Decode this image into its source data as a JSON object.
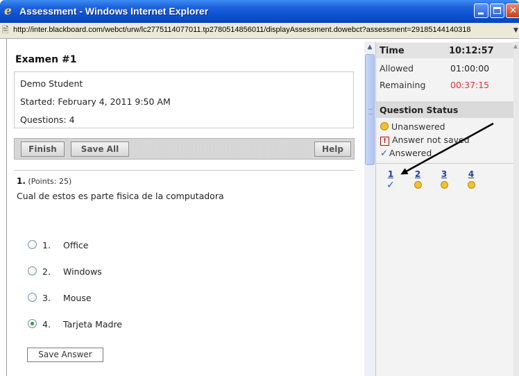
{
  "window": {
    "title": "Assessment - Windows Internet Explorer",
    "url": "http://inter.blackboard.com/webct/urw/lc2775114077011.tp2780514856011/displayAssessment.dowebct?assessment=29185144140318"
  },
  "exam": {
    "title": "Examen #1",
    "student": "Demo Student",
    "started": "Started: February 4, 2011 9:50 AM",
    "questions": "Questions: 4"
  },
  "toolbar": {
    "finish_label": "Finish",
    "save_all_label": "Save All",
    "help_label": "Help"
  },
  "question": {
    "number": "1.",
    "points": "(Points: 25)",
    "text": "Cual de estos es parte fisica de la computadora",
    "options": [
      {
        "num": "1.",
        "label": "Office",
        "selected": false
      },
      {
        "num": "2.",
        "label": "Windows",
        "selected": false
      },
      {
        "num": "3.",
        "label": "Mouse",
        "selected": false
      },
      {
        "num": "4.",
        "label": "Tarjeta Madre",
        "selected": true
      }
    ],
    "save_answer_label": "Save Answer"
  },
  "timer": {
    "label": "Time",
    "current": "10:12:57",
    "allowed_label": "Allowed",
    "allowed_value": "01:00:00",
    "remaining_label": "Remaining",
    "remaining_value": "00:37:15",
    "remaining_color": "#e23232"
  },
  "status": {
    "heading": "Question Status",
    "legend": {
      "unanswered": "Unanswered",
      "not_saved": "Answer not saved",
      "answered": "Answered"
    },
    "questions": [
      {
        "label": "1",
        "state": "answered"
      },
      {
        "label": "2",
        "state": "unanswered"
      },
      {
        "label": "3",
        "state": "unanswered"
      },
      {
        "label": "4",
        "state": "unanswered"
      }
    ]
  },
  "icons": {
    "browser": "ie-logo-icon",
    "page": "page-icon",
    "unanswered": "yellow-dot-icon",
    "not_saved": "exclamation-box-icon",
    "answered": "checkmark-icon"
  },
  "colors": {
    "titlebar": "#0a4fd1",
    "link": "#1f3ea8",
    "answered_check": "#2a4fb8",
    "unanswered_dot": "#f2c12e"
  }
}
